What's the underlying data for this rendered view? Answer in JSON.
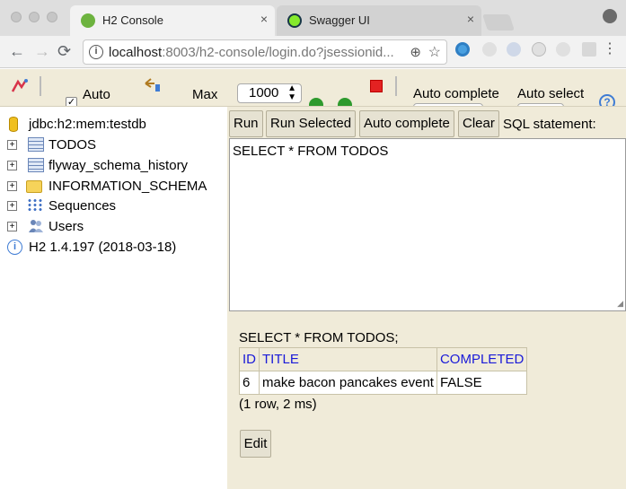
{
  "browser": {
    "tabs": [
      {
        "label": "H2 Console",
        "icon": "spring-leaf-icon",
        "active": true
      },
      {
        "label": "Swagger UI",
        "icon": "swagger-icon",
        "active": false
      }
    ],
    "close_glyph": "×",
    "url_host": "localhost",
    "url_rest": ":8003/h2-console/login.do?jsessionid...",
    "nav": {
      "back": "←",
      "forward": "→",
      "reload": "⟳"
    },
    "info_glyph": "i",
    "zoom_glyph": "⊕",
    "star_glyph": "☆",
    "menu_glyph": "⋮"
  },
  "h2_toolbar": {
    "auto_commit_label": "Auto",
    "max_label": "Max",
    "max_value": "1000",
    "auto_complete_label": "Auto complete",
    "auto_select_label": "Auto select",
    "help_glyph": "?"
  },
  "tree": {
    "connection": "jdbc:h2:mem:testdb",
    "items": [
      {
        "label": "TODOS",
        "icon": "table-icon"
      },
      {
        "label": "flyway_schema_history",
        "icon": "table-icon"
      },
      {
        "label": "INFORMATION_SCHEMA",
        "icon": "folder-icon"
      },
      {
        "label": "Sequences",
        "icon": "sequence-icon"
      },
      {
        "label": "Users",
        "icon": "users-icon"
      }
    ],
    "version": "H2 1.4.197 (2018-03-18)",
    "expand_glyph": "+"
  },
  "query_bar": {
    "run": "Run",
    "run_selected": "Run Selected",
    "auto_complete": "Auto complete",
    "clear": "Clear",
    "sql_label": "SQL statement:"
  },
  "editor": {
    "sql": "SELECT * FROM TODOS"
  },
  "results": {
    "statement": "SELECT * FROM TODOS;",
    "columns": [
      "ID",
      "TITLE",
      "COMPLETED"
    ],
    "rows": [
      [
        "6",
        "make bacon pancakes event",
        "FALSE"
      ]
    ],
    "summary": "(1 row, 2 ms)",
    "edit_label": "Edit"
  },
  "colors": {
    "panel_bg": "#f0ebd9",
    "link_blue": "#1a1ad8",
    "run_green": "#2e9a2e",
    "stop_red": "#e32222"
  }
}
